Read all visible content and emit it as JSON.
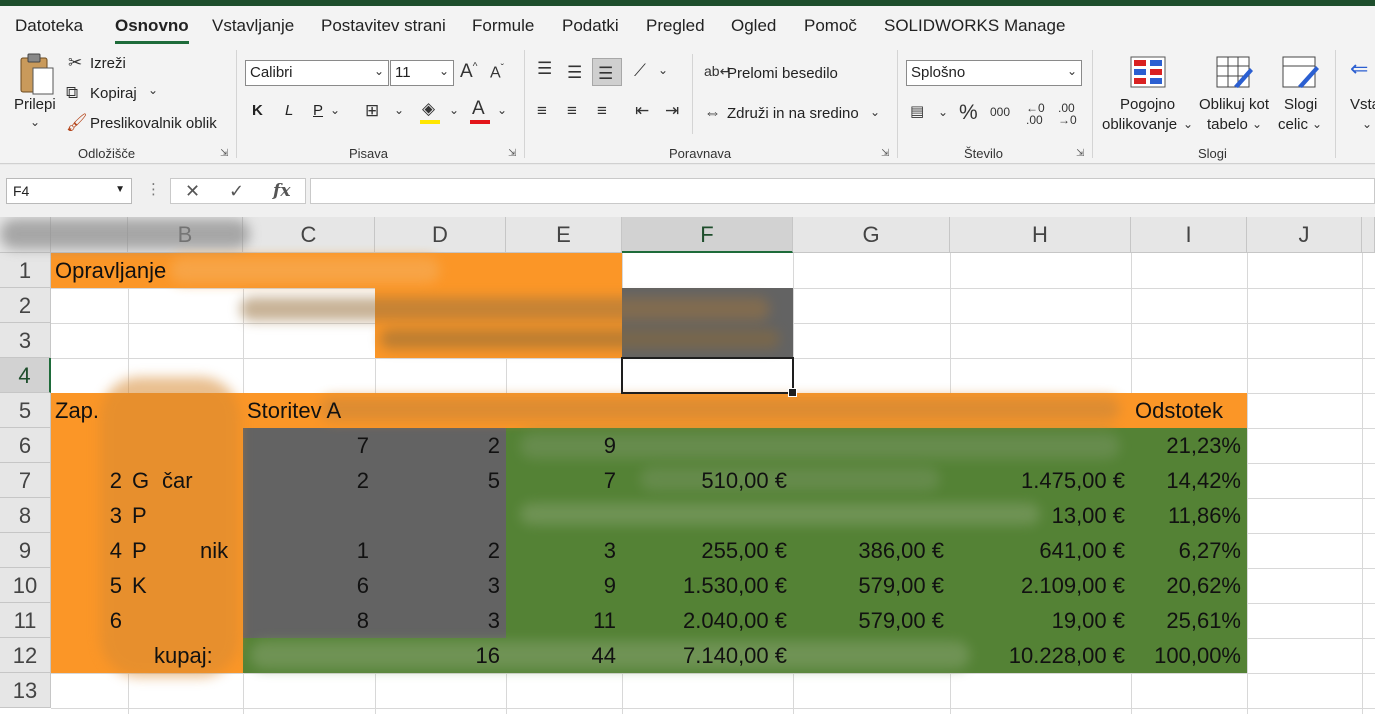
{
  "tabs": [
    "Datoteka",
    "Osnovno",
    "Vstavljanje",
    "Postavitev strani",
    "Formule",
    "Podatki",
    "Pregled",
    "Ogled",
    "Pomoč",
    "SOLIDWORKS Manage"
  ],
  "ribbon": {
    "clipboard": {
      "paste": "Prilepi",
      "cut": "Izreži",
      "copy": "Kopiraj",
      "format_painter": "Preslikovalnik oblik",
      "label": "Odložišče"
    },
    "font": {
      "name": "Calibri",
      "size": "11",
      "bold": "K",
      "italic": "L",
      "underline": "P",
      "label": "Pisava"
    },
    "alignment": {
      "wrap": "Prelomi besedilo",
      "merge": "Združi in na sredino",
      "label": "Poravnava"
    },
    "number": {
      "format": "Splošno",
      "label": "Število"
    },
    "styles": {
      "conditional_l1": "Pogojno",
      "conditional_l2": "oblikovanje",
      "table_l1": "Oblikuj kot",
      "table_l2": "tabelo",
      "cell_l1": "Slogi",
      "cell_l2": "celic",
      "label": "Slogi"
    },
    "insert_cut": "Vsta"
  },
  "formula_bar": {
    "name_box": "F4",
    "cancel": "✕",
    "enter": "✓",
    "fx": "fx",
    "content": ""
  },
  "columns": [
    "B",
    "C",
    "D",
    "E",
    "F",
    "G",
    "H",
    "I",
    "J"
  ],
  "rows": [
    "1",
    "2",
    "3",
    "4",
    "5",
    "6",
    "7",
    "8",
    "9",
    "10",
    "11",
    "12",
    "13"
  ],
  "sheet": {
    "title": "Opravljanje",
    "headers": {
      "zap": "Zap.",
      "storitev": "Storitev A",
      "odstotek": "Odstotek"
    },
    "row6": {
      "c": "7",
      "d": "2",
      "e": "9",
      "h": "",
      "i": "21,23%"
    },
    "row7": {
      "a": "2",
      "b": "G",
      "b2": "čar",
      "c": "2",
      "d": "5",
      "e": "7",
      "f": "510,00 €",
      "h": "1.475,00 €",
      "i": "14,42%"
    },
    "row8": {
      "a": "3",
      "b": "P",
      "h": "13,00 €",
      "i": "11,86%"
    },
    "row9": {
      "a": "4",
      "b": "P",
      "b2": "nik",
      "c": "1",
      "d": "2",
      "e": "3",
      "f": "255,00 €",
      "g": "386,00 €",
      "h": "641,00 €",
      "i": "6,27%"
    },
    "row10": {
      "a": "5",
      "b": "K",
      "c": "6",
      "d": "3",
      "e": "9",
      "f": "1.530,00 €",
      "g": "579,00 €",
      "h": "2.109,00 €",
      "i": "20,62%"
    },
    "row11": {
      "a": "6",
      "c": "8",
      "d": "3",
      "e": "11",
      "f": "2.040,00 €",
      "g": "579,00 €",
      "h": "19,00 €",
      "i": "25,61%"
    },
    "row12": {
      "b": "kupaj:",
      "d": "16",
      "e": "44",
      "f": "7.140,00 €",
      "h": "10.228,00 €",
      "i": "100,00%"
    }
  },
  "colors": {
    "orange": "#fb9627",
    "green": "#548235",
    "gray": "#636363",
    "excel_green": "#1e6b3a"
  }
}
